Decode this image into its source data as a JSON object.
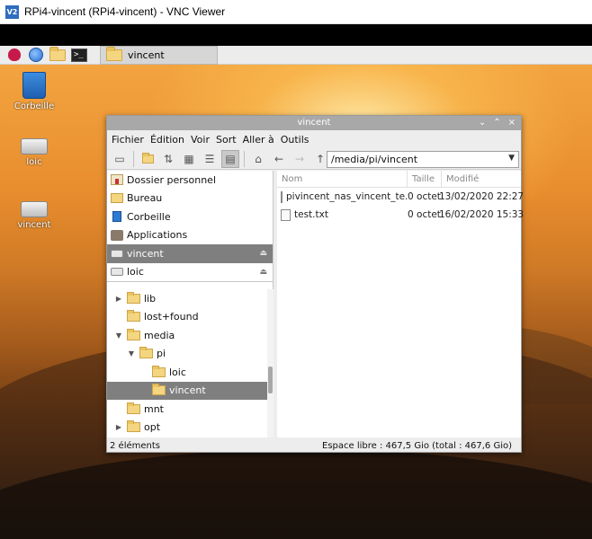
{
  "vnc": {
    "logo": "V2",
    "title": "RPi4-vincent (RPi4-vincent) - VNC Viewer"
  },
  "taskbar": {
    "task_label": "vincent"
  },
  "desktop": {
    "icons": [
      {
        "label": "Corbeille"
      },
      {
        "label": "loic"
      },
      {
        "label": "vincent"
      }
    ]
  },
  "window": {
    "title": "vincent",
    "controls": [
      "⌄",
      "⌃",
      "×"
    ],
    "menu": [
      "Fichier",
      "Édition",
      "Voir",
      "Sort",
      "Aller à",
      "Outils"
    ],
    "path": "/media/pi/vincent",
    "places": [
      {
        "label": "Dossier personnel",
        "icon": "home-folder-icon"
      },
      {
        "label": "Bureau",
        "icon": "desktop-folder-icon"
      },
      {
        "label": "Corbeille",
        "icon": "trash-icon"
      },
      {
        "label": "Applications",
        "icon": "applications-icon"
      },
      {
        "label": "vincent",
        "icon": "drive-icon",
        "selected": true,
        "eject": "⏏"
      },
      {
        "label": "loic",
        "icon": "drive-icon",
        "selected": false,
        "eject": "⏏"
      }
    ],
    "tree": [
      {
        "label": "lib",
        "arrow": "▶",
        "indent": 0
      },
      {
        "label": "lost+found",
        "arrow": "",
        "indent": 0
      },
      {
        "label": "media",
        "arrow": "▼",
        "indent": 0
      },
      {
        "label": "pi",
        "arrow": "▼",
        "indent": 1
      },
      {
        "label": "loic",
        "arrow": "",
        "indent": 2
      },
      {
        "label": "vincent",
        "arrow": "",
        "indent": 2,
        "selected": true
      },
      {
        "label": "mnt",
        "arrow": "",
        "indent": 0
      },
      {
        "label": "opt",
        "arrow": "▶",
        "indent": 0
      }
    ],
    "columns": {
      "name": "Nom",
      "size": "Taille",
      "date": "Modifié"
    },
    "files": [
      {
        "name": "pivincent_nas_vincent_te...",
        "size": "0 octet",
        "date": "13/02/2020 22:27"
      },
      {
        "name": "test.txt",
        "size": "0 octet",
        "date": "16/02/2020 15:33"
      }
    ],
    "status_left": "2 éléments",
    "status_right": "Espace libre : 467,5 Gio (total : 467,6 Gio)"
  }
}
